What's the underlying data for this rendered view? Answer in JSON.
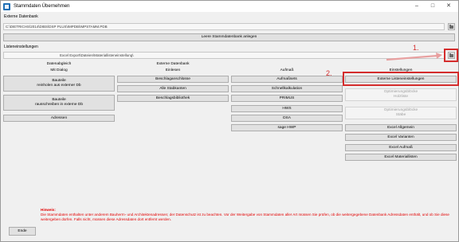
{
  "window": {
    "title": "Stammdaten Übernehmen"
  },
  "externe": {
    "label": "Externe Datenbank",
    "path": "C:\\DIETRICHS\\2014\\DIBS\\DSP PLUS\\IMPDB\\IMPSTAMM.PDB",
    "create_button": "Leere Stammdatenbank anlegen"
  },
  "listen": {
    "label": "Listeneinstellungen",
    "path": "Excel Export\\Dateien\\Materiallisteneinstellung\\"
  },
  "columns": {
    "datenabgleich": "Datenabgleich",
    "mit_dialog": "Mit Dialog",
    "externe_db": "Externe Datenbank",
    "einlesen": "Einlesen",
    "aufmass": "Aufmaß",
    "einstellungen": "Einstellungen"
  },
  "col1": {
    "bauteile_rein": [
      "Bauteile",
      "reinholen aus externer Db"
    ],
    "bauteile_raus": [
      "Bauteile",
      "rausschreiben in externe Db"
    ],
    "adressen": "Adressen"
  },
  "col2": [
    "Beschlaganschlüsse",
    "Alle Stabkanten",
    "Beschlagsbibliothek"
  ],
  "col3": [
    "Aufmaßsets",
    "Schnellkalkulation",
    "PRIMUS",
    "HWS",
    "DSA",
    "sage HWP"
  ],
  "col4": {
    "externe_listen": "Externe Listeneinstellungen",
    "opt_holzliste": [
      "Optimierungsblöcke",
      "Holzliste"
    ],
    "opt_staebe": [
      "Optimierungsblöcke",
      "Stäbe"
    ],
    "excel": [
      "Excel Allgemein",
      "Excel Varianten",
      "Excel Aufmaß",
      "Excel Materiallisten"
    ]
  },
  "annotations": {
    "one": "1.",
    "two": "2."
  },
  "footer": {
    "ende": "Ende",
    "hinweis_title": "Hinweis:",
    "hinweis_text": "Die Stammdaten enthalten unter anderem Bauherrn- und Architektenadressen; der Datenschutz ist zu beachten. Vor der Weitergabe von Stammdaten aller Art müssen Sie prüfen, ob die weitergegebene Datenbank Adressdaten enthält, und ob Sie diese weitergeben dürfen. Falls nicht, müssen diese Adressdaten dort entfernt werden."
  },
  "colors": {
    "annotation": "#d42c2c",
    "warning": "#e30000"
  }
}
